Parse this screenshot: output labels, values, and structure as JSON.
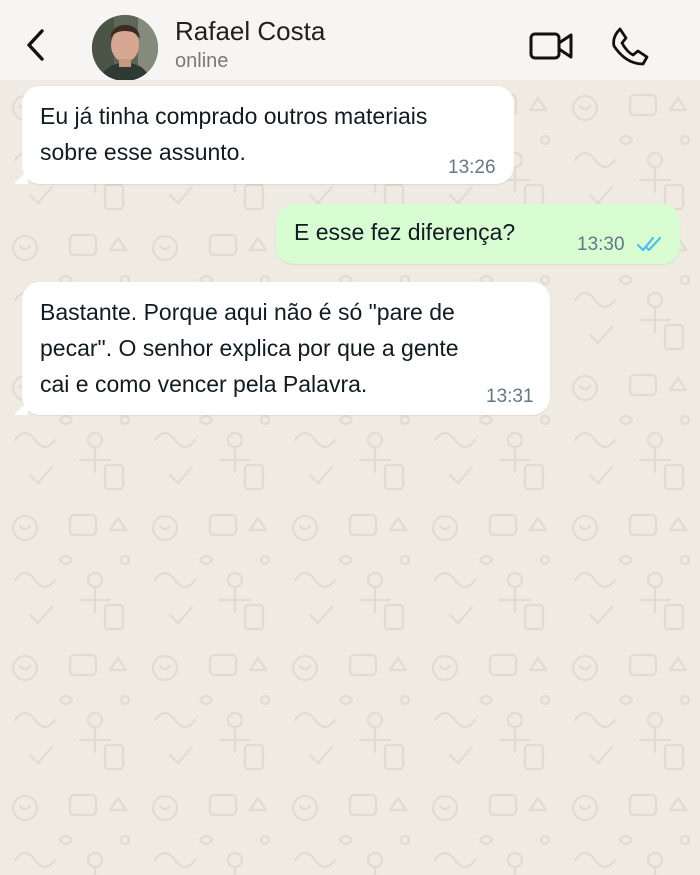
{
  "contact": {
    "name": "Rafael Costa",
    "status": "online"
  },
  "icons": {
    "back": "chevron-left-icon",
    "video": "video-camera-icon",
    "call": "phone-icon",
    "read_receipt": "double-check-icon"
  },
  "colors": {
    "header_bg": "#f6f5f3",
    "chat_bg": "#efeae2",
    "incoming_bubble": "#ffffff",
    "outgoing_bubble": "#d9fdd3",
    "read_tick": "#53bdeb"
  },
  "messages": [
    {
      "direction": "incoming",
      "text": "Eu já tinha comprado outros materiais\nsobre esse assunto.",
      "time": "13:26"
    },
    {
      "direction": "outgoing",
      "text": "E esse fez diferença?",
      "time": "13:30",
      "status": "read"
    },
    {
      "direction": "incoming",
      "text": "Bastante. Porque aqui não é só \"pare de\npecar\". O senhor explica por que a gente\ncai e como vencer pela Palavra.",
      "time": "13:31"
    }
  ]
}
